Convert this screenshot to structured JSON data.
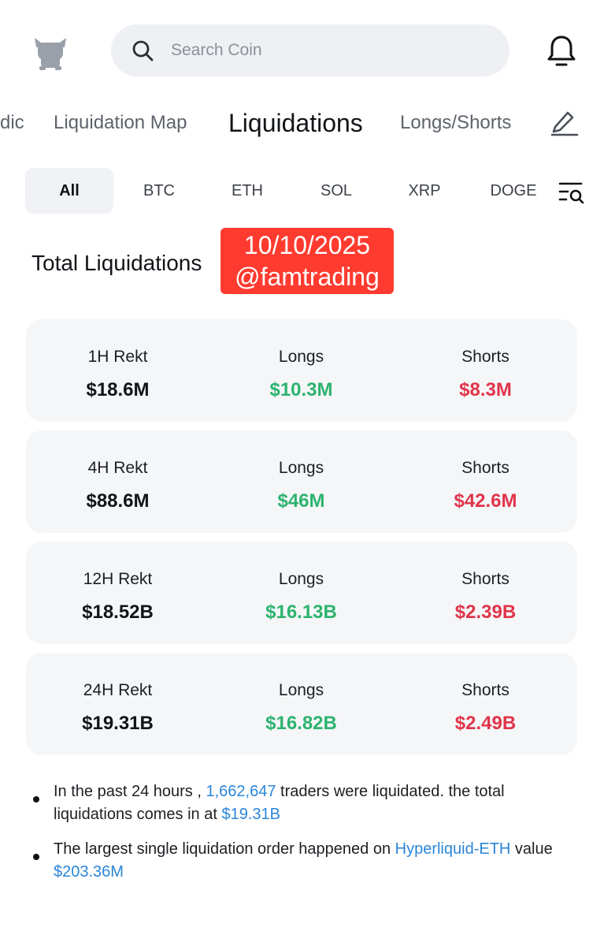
{
  "header": {
    "search_placeholder": "Search Coin"
  },
  "nav": {
    "tabs": [
      {
        "label": "dic"
      },
      {
        "label": "Liquidation Map"
      },
      {
        "label": "Liquidations",
        "active": true
      },
      {
        "label": "Longs/Shorts"
      }
    ]
  },
  "coins": [
    "All",
    "BTC",
    "ETH",
    "SOL",
    "XRP",
    "DOGE"
  ],
  "section": {
    "title": "Total Liquidations",
    "sticker_line1": "10/10/2025",
    "sticker_line2": "@famtrading"
  },
  "cards": [
    {
      "period": "1H  Rekt",
      "total": "$18.6M",
      "longs_label": "Longs",
      "longs": "$10.3M",
      "shorts_label": "Shorts",
      "shorts": "$8.3M"
    },
    {
      "period": "4H Rekt",
      "total": "$88.6M",
      "longs_label": "Longs",
      "longs": "$46M",
      "shorts_label": "Shorts",
      "shorts": "$42.6M"
    },
    {
      "period": "12H Rekt",
      "total": "$18.52B",
      "longs_label": "Longs",
      "longs": "$16.13B",
      "shorts_label": "Shorts",
      "shorts": "$2.39B"
    },
    {
      "period": "24H Rekt",
      "total": "$19.31B",
      "longs_label": "Longs",
      "longs": "$16.82B",
      "shorts_label": "Shorts",
      "shorts": "$2.49B"
    }
  ],
  "summary": {
    "line1_prefix": "In the past 24 hours , ",
    "traders_count": "1,662,647",
    "line1_mid": " traders were liquidated. the total liquidations comes in at ",
    "total_value": "$19.31B",
    "line2_prefix": "The largest single liquidation order happened on ",
    "exchange_pair": "Hyperliquid-ETH",
    "line2_mid": " value ",
    "largest_value": "$203.36M"
  },
  "colors": {
    "long": "#2db36e",
    "short": "#e0354a",
    "link": "#2b85d8",
    "sticker": "#ff3b30"
  }
}
